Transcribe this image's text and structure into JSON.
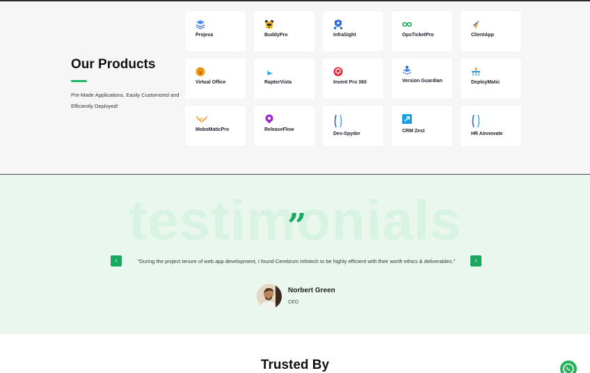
{
  "products": {
    "title": "Our Products",
    "description": "Pre-Made Applications, Easily Customized and Efficiently Deployed!",
    "items": [
      {
        "label": "Projexa",
        "icon": "layers-icon",
        "color": "#2b6fe0"
      },
      {
        "label": "BuddyPro",
        "icon": "bear-icon",
        "color": "#e8b820"
      },
      {
        "label": "InfraSight",
        "icon": "shield-network-icon",
        "color": "#2e6ad6"
      },
      {
        "label": "OpsTicketPro",
        "icon": "infinity-icon",
        "color": "#14a14f"
      },
      {
        "label": "ClientApp",
        "icon": "paper-plane-icon",
        "color": "#f2a81d"
      },
      {
        "label": "Virtual Office",
        "icon": "office-icon",
        "color": "#f29a12"
      },
      {
        "label": "RaptorVista",
        "icon": "bird-icon",
        "color": "#1da1e8"
      },
      {
        "label": "Invent Pro 360",
        "icon": "invent-icon",
        "color": "#e0283a"
      },
      {
        "label": "Version Guardian",
        "icon": "stack-person-icon",
        "color": "#2a66d0"
      },
      {
        "label": "DeployMatic",
        "icon": "deploy-icon",
        "color": "#3a9be0"
      },
      {
        "label": "MoboMaticPro",
        "icon": "wings-icon",
        "color": "#f0a53c"
      },
      {
        "label": "ReleaseFlow",
        "icon": "release-icon",
        "color": "#a324d6"
      },
      {
        "label": "Dev-Spyder",
        "icon": "dna-icon",
        "color": "#2a5fd6"
      },
      {
        "label": "CRM Zest",
        "icon": "arrow-box-icon",
        "color": "#1a9fe0"
      },
      {
        "label": "HR AInnovate",
        "icon": "helix-icon",
        "color": "#2a5fd6"
      }
    ]
  },
  "testimonials": {
    "background_word": "testimonials",
    "quote_glyph": "”",
    "prev_label": "‹",
    "next_label": "›",
    "quote": "\"During the project tenure of web app development, I found Cerebrum Infotech to be highly efficient with their worth ethics & deliverables.\"",
    "author": "Norbert Green",
    "role": "CEO",
    "accent": "#1aa85f"
  },
  "trusted": {
    "title": "Trusted By"
  },
  "whatsapp": {
    "icon": "whatsapp-icon",
    "color": "#25b35a"
  }
}
